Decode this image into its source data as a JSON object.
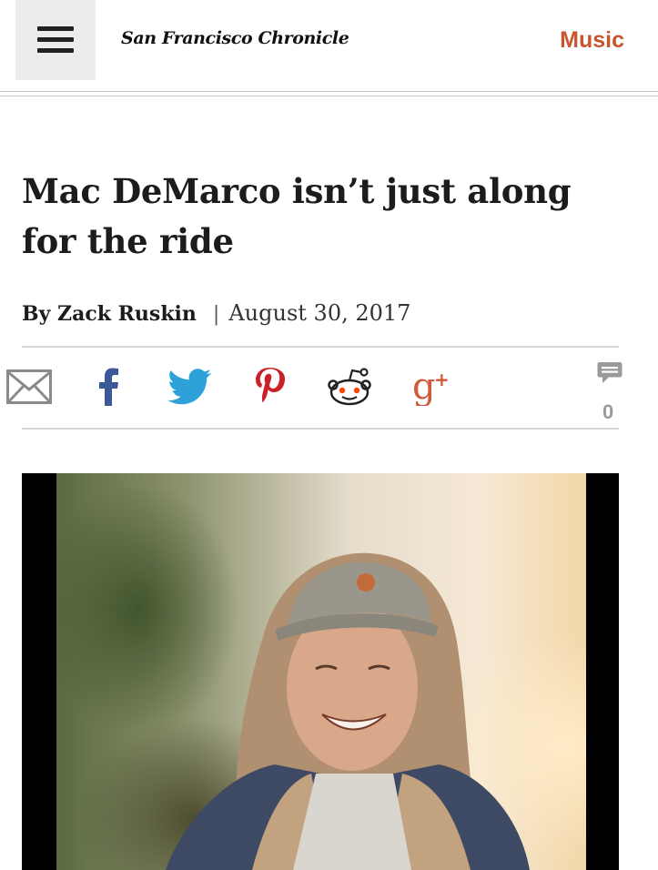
{
  "header": {
    "menu_icon": "hamburger-menu-icon",
    "masthead": "San Francisco Chronicle",
    "section": "Music",
    "section_color": "#c9542f"
  },
  "article": {
    "headline": "Mac DeMarco isn’t just along for the ride",
    "author": "By Zack Ruskin",
    "separator": "|",
    "date": "August 30, 2017"
  },
  "share": {
    "buttons": [
      {
        "name": "email",
        "icon": "envelope-icon",
        "color": "#8a8a8a"
      },
      {
        "name": "facebook",
        "icon": "facebook-icon",
        "color": "#3b5998"
      },
      {
        "name": "twitter",
        "icon": "twitter-bird-icon",
        "color": "#2ea1d9"
      },
      {
        "name": "pinterest",
        "icon": "pinterest-icon",
        "color": "#cb2027"
      },
      {
        "name": "reddit",
        "icon": "reddit-alien-icon",
        "color": "#ff4500"
      },
      {
        "name": "google-plus",
        "icon": "google-plus-icon",
        "color": "#d05a3c"
      }
    ],
    "comments_icon": "comment-bubble-icon",
    "comment_count": "0"
  },
  "photo": {
    "description_icon": "article-photo"
  }
}
